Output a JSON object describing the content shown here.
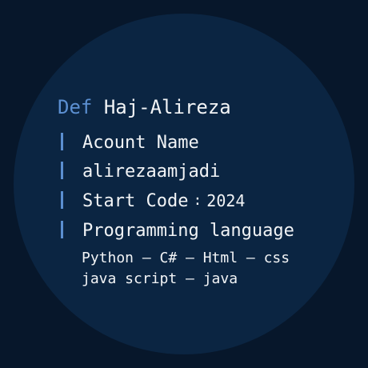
{
  "header": {
    "keyword": "Def",
    "name": "Haj-Alireza"
  },
  "rows": [
    {
      "bar": "|",
      "text": "Acount Name"
    },
    {
      "bar": "|",
      "text": "alirezaamjadi"
    },
    {
      "bar": "|",
      "label": "Start Code",
      "separator": ":",
      "value": "2024"
    },
    {
      "bar": "|",
      "text": "Programming language"
    }
  ],
  "languages": {
    "line1": "Python – C# – Html – css",
    "line2": "java script – java"
  },
  "colors": {
    "background": "#07172b",
    "circle": "#0b2542",
    "accent": "#5b8fd1",
    "text": "#f2f4f6"
  }
}
